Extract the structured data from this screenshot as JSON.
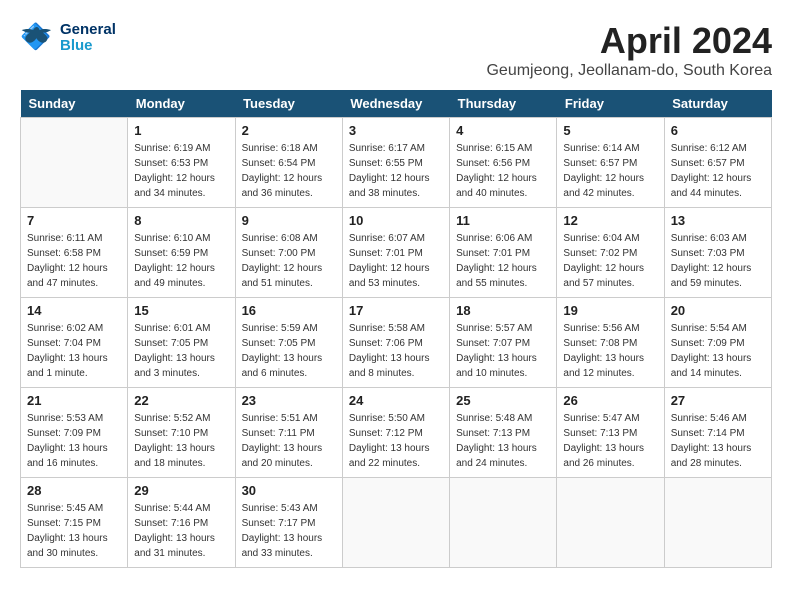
{
  "header": {
    "logo_line1": "General",
    "logo_line2": "Blue",
    "month": "April 2024",
    "location": "Geumjeong, Jeollanam-do, South Korea"
  },
  "weekdays": [
    "Sunday",
    "Monday",
    "Tuesday",
    "Wednesday",
    "Thursday",
    "Friday",
    "Saturday"
  ],
  "weeks": [
    [
      {
        "day": "",
        "info": ""
      },
      {
        "day": "1",
        "info": "Sunrise: 6:19 AM\nSunset: 6:53 PM\nDaylight: 12 hours\nand 34 minutes."
      },
      {
        "day": "2",
        "info": "Sunrise: 6:18 AM\nSunset: 6:54 PM\nDaylight: 12 hours\nand 36 minutes."
      },
      {
        "day": "3",
        "info": "Sunrise: 6:17 AM\nSunset: 6:55 PM\nDaylight: 12 hours\nand 38 minutes."
      },
      {
        "day": "4",
        "info": "Sunrise: 6:15 AM\nSunset: 6:56 PM\nDaylight: 12 hours\nand 40 minutes."
      },
      {
        "day": "5",
        "info": "Sunrise: 6:14 AM\nSunset: 6:57 PM\nDaylight: 12 hours\nand 42 minutes."
      },
      {
        "day": "6",
        "info": "Sunrise: 6:12 AM\nSunset: 6:57 PM\nDaylight: 12 hours\nand 44 minutes."
      }
    ],
    [
      {
        "day": "7",
        "info": "Sunrise: 6:11 AM\nSunset: 6:58 PM\nDaylight: 12 hours\nand 47 minutes."
      },
      {
        "day": "8",
        "info": "Sunrise: 6:10 AM\nSunset: 6:59 PM\nDaylight: 12 hours\nand 49 minutes."
      },
      {
        "day": "9",
        "info": "Sunrise: 6:08 AM\nSunset: 7:00 PM\nDaylight: 12 hours\nand 51 minutes."
      },
      {
        "day": "10",
        "info": "Sunrise: 6:07 AM\nSunset: 7:01 PM\nDaylight: 12 hours\nand 53 minutes."
      },
      {
        "day": "11",
        "info": "Sunrise: 6:06 AM\nSunset: 7:01 PM\nDaylight: 12 hours\nand 55 minutes."
      },
      {
        "day": "12",
        "info": "Sunrise: 6:04 AM\nSunset: 7:02 PM\nDaylight: 12 hours\nand 57 minutes."
      },
      {
        "day": "13",
        "info": "Sunrise: 6:03 AM\nSunset: 7:03 PM\nDaylight: 12 hours\nand 59 minutes."
      }
    ],
    [
      {
        "day": "14",
        "info": "Sunrise: 6:02 AM\nSunset: 7:04 PM\nDaylight: 13 hours\nand 1 minute."
      },
      {
        "day": "15",
        "info": "Sunrise: 6:01 AM\nSunset: 7:05 PM\nDaylight: 13 hours\nand 3 minutes."
      },
      {
        "day": "16",
        "info": "Sunrise: 5:59 AM\nSunset: 7:05 PM\nDaylight: 13 hours\nand 6 minutes."
      },
      {
        "day": "17",
        "info": "Sunrise: 5:58 AM\nSunset: 7:06 PM\nDaylight: 13 hours\nand 8 minutes."
      },
      {
        "day": "18",
        "info": "Sunrise: 5:57 AM\nSunset: 7:07 PM\nDaylight: 13 hours\nand 10 minutes."
      },
      {
        "day": "19",
        "info": "Sunrise: 5:56 AM\nSunset: 7:08 PM\nDaylight: 13 hours\nand 12 minutes."
      },
      {
        "day": "20",
        "info": "Sunrise: 5:54 AM\nSunset: 7:09 PM\nDaylight: 13 hours\nand 14 minutes."
      }
    ],
    [
      {
        "day": "21",
        "info": "Sunrise: 5:53 AM\nSunset: 7:09 PM\nDaylight: 13 hours\nand 16 minutes."
      },
      {
        "day": "22",
        "info": "Sunrise: 5:52 AM\nSunset: 7:10 PM\nDaylight: 13 hours\nand 18 minutes."
      },
      {
        "day": "23",
        "info": "Sunrise: 5:51 AM\nSunset: 7:11 PM\nDaylight: 13 hours\nand 20 minutes."
      },
      {
        "day": "24",
        "info": "Sunrise: 5:50 AM\nSunset: 7:12 PM\nDaylight: 13 hours\nand 22 minutes."
      },
      {
        "day": "25",
        "info": "Sunrise: 5:48 AM\nSunset: 7:13 PM\nDaylight: 13 hours\nand 24 minutes."
      },
      {
        "day": "26",
        "info": "Sunrise: 5:47 AM\nSunset: 7:13 PM\nDaylight: 13 hours\nand 26 minutes."
      },
      {
        "day": "27",
        "info": "Sunrise: 5:46 AM\nSunset: 7:14 PM\nDaylight: 13 hours\nand 28 minutes."
      }
    ],
    [
      {
        "day": "28",
        "info": "Sunrise: 5:45 AM\nSunset: 7:15 PM\nDaylight: 13 hours\nand 30 minutes."
      },
      {
        "day": "29",
        "info": "Sunrise: 5:44 AM\nSunset: 7:16 PM\nDaylight: 13 hours\nand 31 minutes."
      },
      {
        "day": "30",
        "info": "Sunrise: 5:43 AM\nSunset: 7:17 PM\nDaylight: 13 hours\nand 33 minutes."
      },
      {
        "day": "",
        "info": ""
      },
      {
        "day": "",
        "info": ""
      },
      {
        "day": "",
        "info": ""
      },
      {
        "day": "",
        "info": ""
      }
    ]
  ]
}
